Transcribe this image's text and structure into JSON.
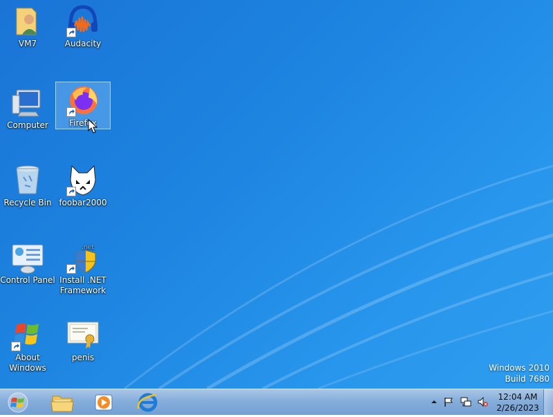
{
  "desktop": {
    "icons": [
      {
        "label": "VM7",
        "icon": "user-folder-icon",
        "shortcut": false
      },
      {
        "label": "Audacity",
        "icon": "headphones-icon",
        "shortcut": true
      },
      {
        "label": "Computer",
        "icon": "computer-icon",
        "shortcut": false
      },
      {
        "label": "Firefox",
        "icon": "firefox-icon",
        "shortcut": true,
        "selected": true
      },
      {
        "label": "Recycle Bin",
        "icon": "recycle-bin-icon",
        "shortcut": false
      },
      {
        "label": "foobar2000",
        "icon": "foobar-icon",
        "shortcut": true
      },
      {
        "label": "Control Panel",
        "icon": "control-panel-icon",
        "shortcut": false
      },
      {
        "label": "Install .NET Framework",
        "icon": "net-shield-icon",
        "shortcut": true
      },
      {
        "label": "About Windows",
        "icon": "windows-flag-icon",
        "shortcut": true
      },
      {
        "label": "penis",
        "icon": "certificate-icon",
        "shortcut": false
      }
    ],
    "watermark": {
      "line1": "Windows 2010",
      "line2": "Build 7680"
    }
  },
  "taskbar": {
    "start_icon": "windows-orb-icon",
    "pinned": [
      {
        "name": "explorer",
        "icon": "folder-explorer-icon"
      },
      {
        "name": "media-player",
        "icon": "media-player-icon"
      },
      {
        "name": "internet-explorer",
        "icon": "internet-explorer-icon"
      }
    ],
    "tray": {
      "icons": [
        "show-hidden-icon",
        "action-center-flag-icon",
        "network-icon",
        "volume-muted-icon"
      ],
      "time": "12:04 AM",
      "date": "2/26/2023"
    }
  },
  "colors": {
    "desktop": "#1d84e0",
    "taskbar": "#86aedb"
  }
}
